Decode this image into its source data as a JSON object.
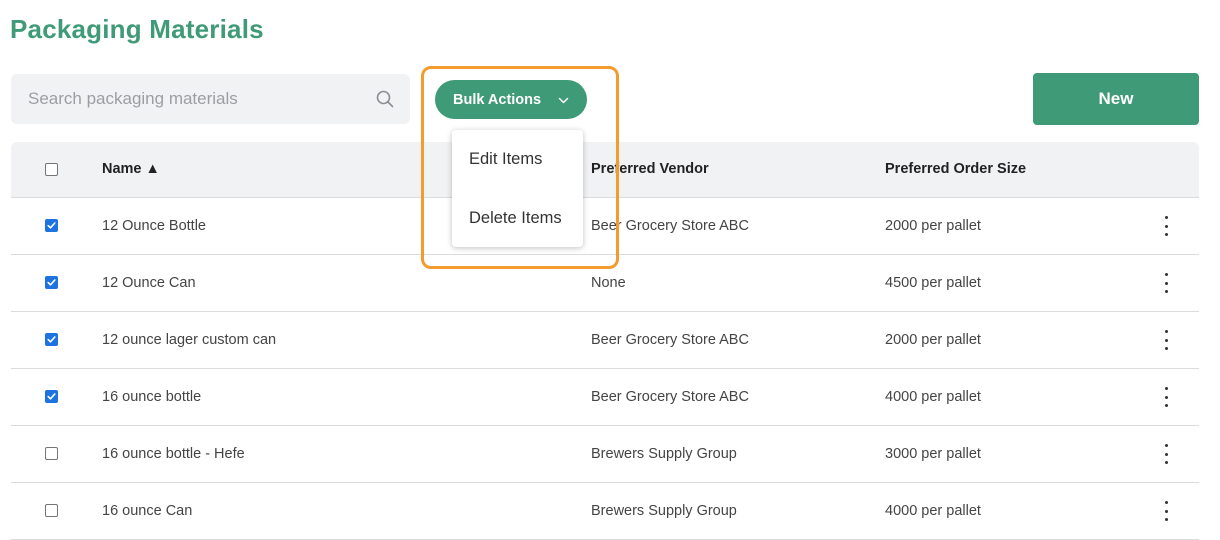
{
  "page": {
    "title": "Packaging Materials"
  },
  "search": {
    "placeholder": "Search packaging materials",
    "value": "",
    "icon": "search-icon"
  },
  "toolbar": {
    "bulk_actions_label": "Bulk Actions",
    "bulk_actions_icon": "chevron-down-icon",
    "new_label": "New"
  },
  "bulk_menu": {
    "items": [
      {
        "label": "Edit Items"
      },
      {
        "label": "Delete Items"
      }
    ]
  },
  "table": {
    "headers": {
      "name": "Name ▲",
      "vendor": "Preferred Vendor",
      "order_size": "Preferred Order Size"
    },
    "select_all_checked": false,
    "rows": [
      {
        "checked": true,
        "name": "12 Ounce Bottle",
        "vendor": "Beer Grocery Store ABC",
        "order_size": "2000 per pallet"
      },
      {
        "checked": true,
        "name": "12 Ounce Can",
        "vendor": "None",
        "order_size": "4500 per pallet"
      },
      {
        "checked": true,
        "name": "12 ounce lager custom can",
        "vendor": "Beer Grocery Store ABC",
        "order_size": "2000 per pallet"
      },
      {
        "checked": true,
        "name": "16 ounce bottle",
        "vendor": "Beer Grocery Store ABC",
        "order_size": "4000 per pallet"
      },
      {
        "checked": false,
        "name": "16 ounce bottle - Hefe",
        "vendor": "Brewers Supply Group",
        "order_size": "3000 per pallet"
      },
      {
        "checked": false,
        "name": "16 ounce Can",
        "vendor": "Brewers Supply Group",
        "order_size": "4000 per pallet"
      }
    ]
  },
  "colors": {
    "brand_green": "#3f9a77",
    "highlight_orange": "#f29b2f",
    "checkbox_blue": "#1f73e0",
    "header_bg": "#f1f2f4"
  }
}
